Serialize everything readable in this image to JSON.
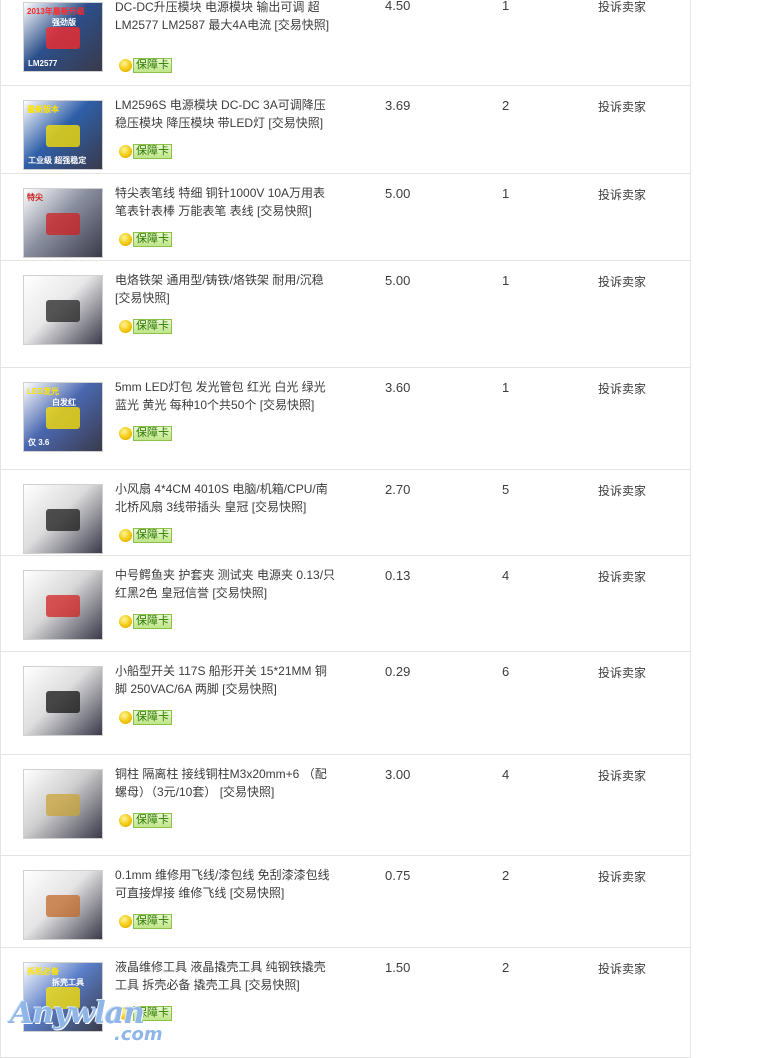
{
  "rows": [
    {
      "title": "DC-DC升压模块 电源模块 输出可调 超 LM2577 LM2587 最大4A电流",
      "snapshot": "[交易快照]",
      "badge": "保障卡",
      "price": "4.50",
      "qty": "1",
      "action": "投诉卖家",
      "thumb": {
        "bg": "#2c4f8a",
        "top_text": "2013年最新升级",
        "mid_text": "强劲版",
        "bot_text": "LM2577",
        "accent": "#ff2a2a"
      }
    },
    {
      "title": "LM2596S 电源模块 DC-DC 3A可调降压稳压模块 降压模块 带LED灯",
      "snapshot": "[交易快照]",
      "badge": "保障卡",
      "price": "3.69",
      "qty": "2",
      "action": "投诉卖家",
      "thumb": {
        "bg": "#2f5fa8",
        "top_text": "最新版本",
        "mid_text": "",
        "bot_text": "工业级 超强稳定",
        "accent": "#ffe400"
      }
    },
    {
      "title": "特尖表笔线 特细 铜针1000V 10A万用表笔表针表棒 万能表笔 表线",
      "snapshot": "[交易快照]",
      "badge": "保障卡",
      "price": "5.00",
      "qty": "1",
      "action": "投诉卖家",
      "thumb": {
        "bg": "#8a8fa0",
        "top_text": "特尖",
        "mid_text": "",
        "bot_text": "",
        "accent": "#d02020"
      }
    },
    {
      "title": "电烙铁架 通用型/铸铁/烙铁架 耐用/沉稳",
      "snapshot": "[交易快照]",
      "badge": "保障卡",
      "price": "5.00",
      "qty": "1",
      "action": "投诉卖家",
      "thumb": {
        "bg": "#e8e8e8",
        "top_text": "",
        "mid_text": "",
        "bot_text": "",
        "accent": "#222222"
      }
    },
    {
      "title": "5mm LED灯包 发光管包 红光 白光 绿光 蓝光 黄光 每种10个共50个",
      "snapshot": "[交易快照]",
      "badge": "保障卡",
      "price": "3.60",
      "qty": "1",
      "action": "投诉卖家",
      "thumb": {
        "bg": "#4a68b0",
        "top_text": "LED发光",
        "mid_text": "白发红",
        "bot_text": "仅 3.6",
        "accent": "#ffe400"
      }
    },
    {
      "title": "小风扇 4*4CM 4010S 电脑/机箱/CPU/南北桥风扇 3线带插头 皇冠",
      "snapshot": "[交易快照]",
      "badge": "保障卡",
      "price": "2.70",
      "qty": "5",
      "action": "投诉卖家",
      "thumb": {
        "bg": "#dcdcdc",
        "top_text": "",
        "mid_text": "",
        "bot_text": "",
        "accent": "#1a1a1a"
      }
    },
    {
      "title": "中号鳄鱼夹 护套夹 测试夹 电源夹 0.13/只 红黑2色 皇冠信誉",
      "snapshot": "[交易快照]",
      "badge": "保障卡",
      "price": "0.13",
      "qty": "4",
      "action": "投诉卖家",
      "thumb": {
        "bg": "#d8d8d8",
        "top_text": "",
        "mid_text": "",
        "bot_text": "",
        "accent": "#d22222"
      }
    },
    {
      "title": "小船型开关 117S 船形开关 15*21MM 铜脚 250VAC/6A 两脚",
      "snapshot": "[交易快照]",
      "badge": "保障卡",
      "price": "0.29",
      "qty": "6",
      "action": "投诉卖家",
      "thumb": {
        "bg": "#dedede",
        "top_text": "",
        "mid_text": "",
        "bot_text": "",
        "accent": "#111111"
      }
    },
    {
      "title": "铜柱 隔离柱 接线铜柱M3x20mm+6 （配螺母）（3元/10套）",
      "snapshot": "[交易快照]",
      "badge": "保障卡",
      "price": "3.00",
      "qty": "4",
      "action": "投诉卖家",
      "thumb": {
        "bg": "#cfcfcf",
        "top_text": "",
        "mid_text": "",
        "bot_text": "",
        "accent": "#c9a43a"
      }
    },
    {
      "title": "0.1mm 维修用飞线/漆包线 免刮漆漆包线 可直接焊接 维修飞线",
      "snapshot": "[交易快照]",
      "badge": "保障卡",
      "price": "0.75",
      "qty": "2",
      "action": "投诉卖家",
      "thumb": {
        "bg": "#e4e4e4",
        "top_text": "",
        "mid_text": "",
        "bot_text": "",
        "accent": "#c2692a"
      }
    },
    {
      "title": "液晶维修工具 液晶撬壳工具 纯钢铁撬壳工具 拆壳必备 撬壳工具",
      "snapshot": "[交易快照]",
      "badge": "保障卡",
      "price": "1.50",
      "qty": "2",
      "action": "投诉卖家",
      "thumb": {
        "bg": "#5a7ec8",
        "top_text": "拆机必备",
        "mid_text": "拆壳工具",
        "bot_text": "",
        "accent": "#ffe400"
      }
    }
  ],
  "watermark": {
    "main": "Anywlan",
    "sub": ".com"
  }
}
